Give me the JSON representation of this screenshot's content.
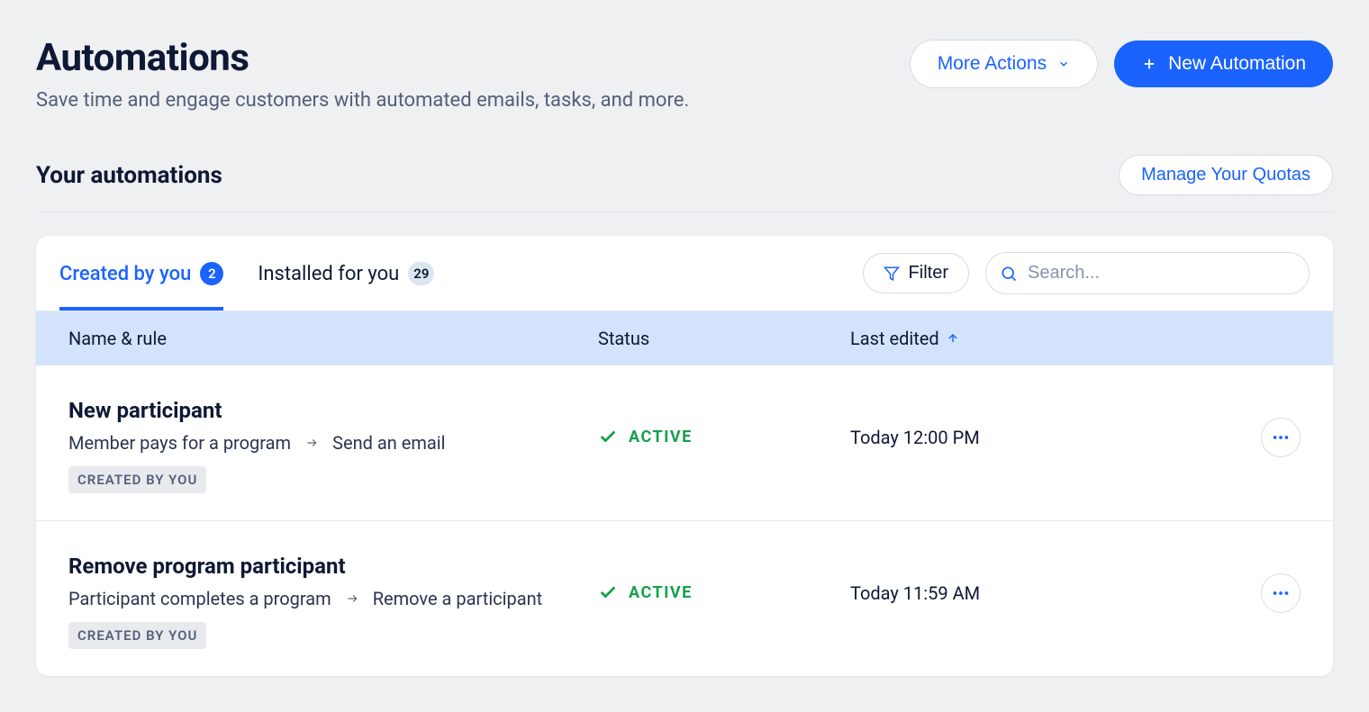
{
  "header": {
    "title": "Automations",
    "subtitle": "Save time and engage customers with automated emails, tasks, and more.",
    "more_actions_label": "More Actions",
    "new_automation_label": "New Automation"
  },
  "subheader": {
    "title": "Your automations",
    "manage_quotas_label": "Manage Your Quotas"
  },
  "tabs": {
    "created": {
      "label": "Created by you",
      "count": "2"
    },
    "installed": {
      "label": "Installed for you",
      "count": "29"
    }
  },
  "controls": {
    "filter_label": "Filter",
    "search_placeholder": "Search..."
  },
  "columns": {
    "name": "Name & rule",
    "status": "Status",
    "last_edited": "Last edited"
  },
  "rows": [
    {
      "name": "New participant",
      "rule_trigger": "Member pays for a program",
      "rule_action": "Send an email",
      "tag": "CREATED BY YOU",
      "status": "ACTIVE",
      "last_edited": "Today 12:00 PM"
    },
    {
      "name": "Remove program participant",
      "rule_trigger": "Participant completes a program",
      "rule_action": "Remove a participant",
      "tag": "CREATED BY YOU",
      "status": "ACTIVE",
      "last_edited": "Today 11:59 AM"
    }
  ]
}
